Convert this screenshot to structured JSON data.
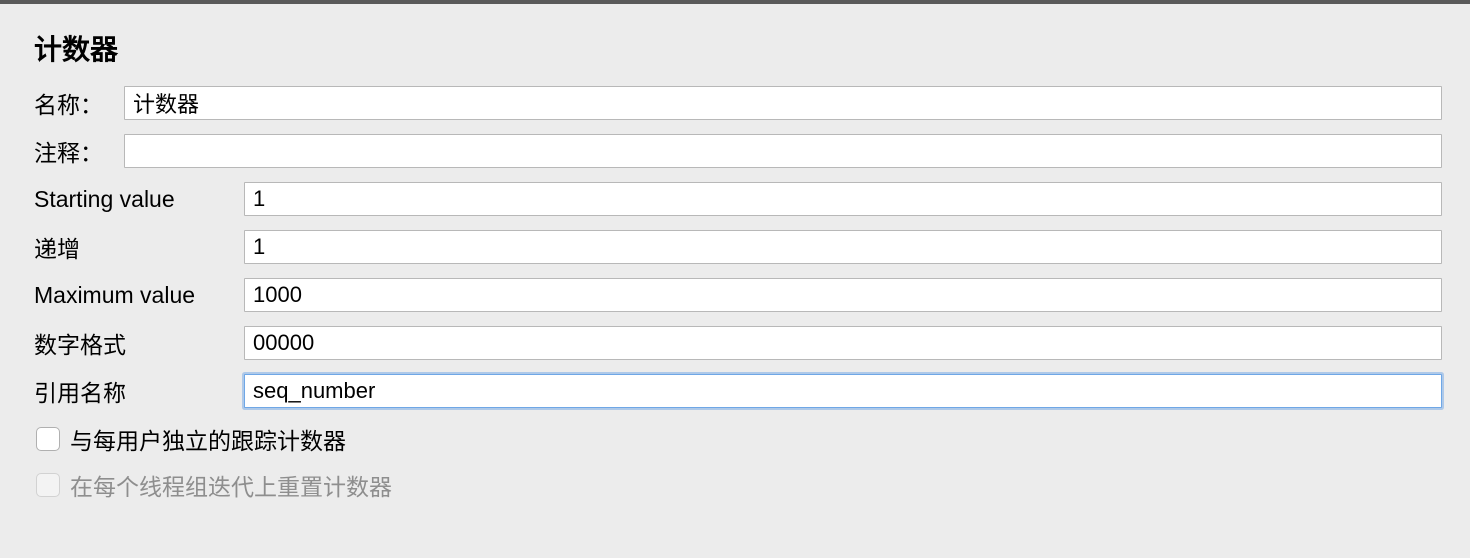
{
  "title": "计数器",
  "fields": {
    "name": {
      "label": "名称：",
      "value": "计数器"
    },
    "comment": {
      "label": "注释：",
      "value": ""
    },
    "start": {
      "label": "Starting value",
      "value": "1"
    },
    "increment": {
      "label": "递增",
      "value": "1"
    },
    "max": {
      "label": "Maximum value",
      "value": "1000"
    },
    "format": {
      "label": "数字格式",
      "value": "00000"
    },
    "refname": {
      "label": "引用名称",
      "value": "seq_number"
    }
  },
  "checks": {
    "perUser": {
      "label": "与每用户独立的跟踪计数器",
      "checked": false,
      "enabled": true
    },
    "resetPerIter": {
      "label": "在每个线程组迭代上重置计数器",
      "checked": false,
      "enabled": false
    }
  }
}
